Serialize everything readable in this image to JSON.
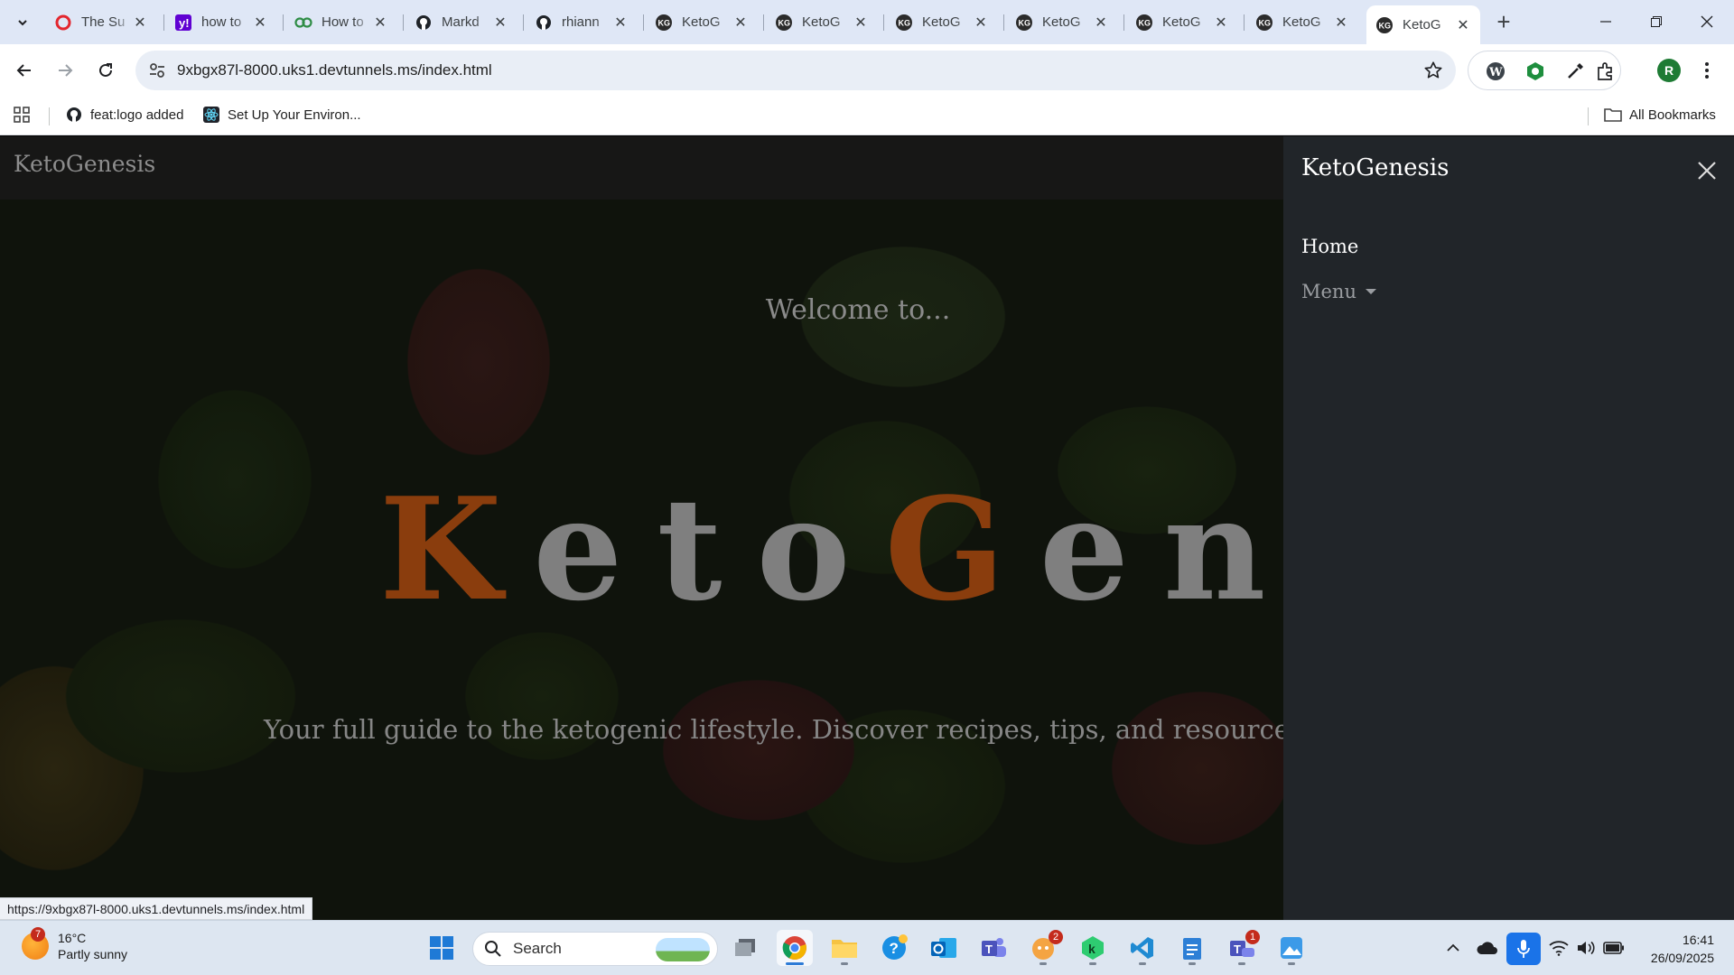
{
  "browser": {
    "tabs": [
      {
        "label": "The Su",
        "favicon": "opera-icon"
      },
      {
        "label": "how to",
        "favicon": "yahoo-icon"
      },
      {
        "label": "How to",
        "favicon": "geeksforgeeks-icon"
      },
      {
        "label": "Markd",
        "favicon": "github-icon"
      },
      {
        "label": "rhiann",
        "favicon": "github-icon"
      },
      {
        "label": "KetoG",
        "favicon": "kg-icon"
      },
      {
        "label": "KetoG",
        "favicon": "kg-icon"
      },
      {
        "label": "KetoG",
        "favicon": "kg-icon"
      },
      {
        "label": "KetoG",
        "favicon": "kg-icon"
      },
      {
        "label": "KetoG",
        "favicon": "kg-icon"
      },
      {
        "label": "KetoG",
        "favicon": "kg-icon"
      },
      {
        "label": "KetoG",
        "favicon": "kg-icon",
        "active": true
      }
    ],
    "favicon_text": "KG",
    "address": "9xbgx87l-8000.uks1.devtunnels.ms/index.html",
    "profile_initial": "R",
    "bookmarks": [
      {
        "label": "feat:logo added",
        "icon": "github-icon"
      },
      {
        "label": "Set Up Your Environ...",
        "icon": "react-icon"
      }
    ],
    "all_bookmarks_label": "All Bookmarks",
    "status_url": "https://9xbgx87l-8000.uks1.devtunnels.ms/index.html"
  },
  "page": {
    "navbar_brand": "KetoGenesis",
    "welcome": "Welcome to...",
    "hero_title_k": "K",
    "hero_title_eto": "eto",
    "hero_title_g": "G",
    "hero_title_enesis": "enesis",
    "tagline": "Your full guide to the ketogenic lifestyle. Discover recipes, tips, and resources for a successful",
    "accent_color": "#8a3d0d",
    "offcanvas": {
      "title": "KetoGenesis",
      "home_label": "Home",
      "menu_label": "Menu"
    }
  },
  "taskbar": {
    "weather_temp": "16°C",
    "weather_desc": "Partly sunny",
    "weather_badge": "7",
    "search_label": "Search",
    "discord_badge": "2",
    "teams_badge": "1",
    "time": "16:41",
    "date": "26/09/2025"
  }
}
